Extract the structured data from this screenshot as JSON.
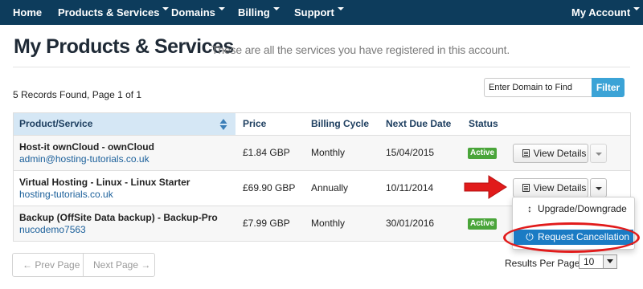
{
  "nav": {
    "items": [
      {
        "label": "Home",
        "has_caret": false
      },
      {
        "label": "Products & Services",
        "has_caret": true
      },
      {
        "label": "Domains",
        "has_caret": true
      },
      {
        "label": "Billing",
        "has_caret": true
      },
      {
        "label": "Support",
        "has_caret": true
      }
    ],
    "account": {
      "label": "My Account",
      "has_caret": true
    }
  },
  "header": {
    "title": "My Products & Services",
    "subtitle": "These are all the services you have registered in this account."
  },
  "records_text": "5 Records Found, Page 1 of 1",
  "filter": {
    "placeholder": "Enter Domain to Find",
    "button": "Filter"
  },
  "table": {
    "columns": [
      "Product/Service",
      "Price",
      "Billing Cycle",
      "Next Due Date",
      "Status"
    ],
    "rows": [
      {
        "product": "Host-it ownCloud - ownCloud",
        "domain": "admin@hosting-tutorials.co.uk",
        "price": "£1.84 GBP",
        "cycle": "Monthly",
        "due": "15/04/2015",
        "status": "Active",
        "action": "View Details"
      },
      {
        "product": "Virtual Hosting - Linux - Linux Starter",
        "domain": "hosting-tutorials.co.uk",
        "price": "£69.90 GBP",
        "cycle": "Annually",
        "due": "10/11/2014",
        "status": "",
        "action": "View Details"
      },
      {
        "product": "Backup (OffSite Data backup) - Backup-Pro",
        "domain": "nucodemo7563",
        "price": "£7.99 GBP",
        "cycle": "Monthly",
        "due": "30/01/2016",
        "status": "Active",
        "action": ""
      }
    ]
  },
  "dropdown": {
    "items": [
      {
        "label": "Upgrade/Downgrade",
        "icon": "up-down-arrow-icon"
      },
      {
        "label": "Request Cancellation",
        "icon": "power-icon"
      }
    ]
  },
  "pagination": {
    "prev": "← Prev Page",
    "next": "Next Page →"
  },
  "results_per_page": {
    "label": "Results Per Page:",
    "value": "10"
  },
  "colors": {
    "nav_bg": "#0d3c5c",
    "header_product_bg": "#d5e7f5",
    "active_badge": "#4aa53a",
    "filter_button": "#3ba3d6",
    "dropdown_active": "#1b7bc4",
    "annotation_red": "#e11b1b"
  }
}
